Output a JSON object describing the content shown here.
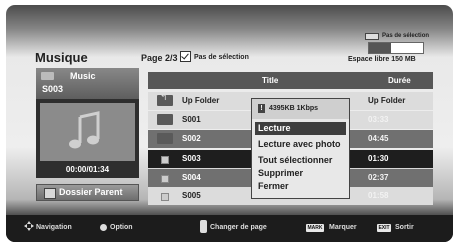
{
  "header": {
    "title": "Musique",
    "page": "Page 2/3",
    "select_none": "Pas de sélection",
    "device_label": "Pas de sélection",
    "storage_fraction_used": 0.4,
    "free_space": "Espace libre 150 MB"
  },
  "info_panel": {
    "folder": "Music",
    "selected": "S003",
    "time": "00:00/01:34",
    "parent_button": "Dossier Parent"
  },
  "table": {
    "columns": [
      "Title",
      "Durée"
    ],
    "rows": [
      {
        "name": "Up Folder",
        "duration": "Up Folder",
        "icon": "up-folder-icon"
      },
      {
        "name": "S001",
        "duration": "03:33",
        "icon": "folder-icon"
      },
      {
        "name": "S002",
        "duration": "04:45",
        "icon": "folder-icon"
      },
      {
        "name": "S003",
        "duration": "01:30",
        "icon": "music-file-icon"
      },
      {
        "name": "S004",
        "duration": "02:37",
        "icon": "music-file-icon"
      },
      {
        "name": "S005",
        "duration": "01:58",
        "icon": "music-file-icon"
      }
    ]
  },
  "popup": {
    "info": "4395KB 1Kbps",
    "options": [
      "Lecture",
      "Lecture avec photo",
      "Tout sélectionner",
      "Supprimer",
      "Fermer"
    ]
  },
  "legend": {
    "navigation": "Navigation",
    "option": "Option",
    "change_page": "Changer de page",
    "mark_key": "MARK",
    "mark": "Marquer",
    "exit_key": "EXIT",
    "exit": "Sortir"
  },
  "colors": {
    "row_dark": "#707070",
    "row_light": "#dcdcdc",
    "row_selected": "#1e1e1e",
    "popup_highlight": "#3e3e3e"
  }
}
